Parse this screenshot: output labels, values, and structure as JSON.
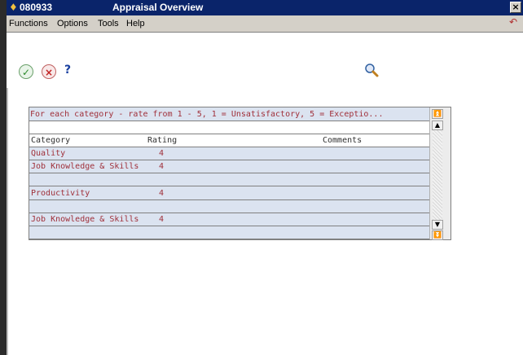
{
  "window": {
    "id": "080933",
    "title": "Appraisal Overview",
    "close_label": "×"
  },
  "menu": {
    "items": [
      "Functions",
      "Options",
      "Tools",
      "Help"
    ]
  },
  "toolbar": {
    "ok_icon": "checkmark-icon",
    "cancel_icon": "cancel-icon",
    "help_label": "?",
    "search_icon": "magnifier-icon"
  },
  "grid": {
    "instruction": "For each category - rate from 1 - 5, 1 = Unsatisfactory, 5 = Exceptio...",
    "columns": [
      "Category",
      "Rating",
      "Comments"
    ],
    "rows": [
      {
        "category": "",
        "rating": "",
        "comments": ""
      },
      {
        "category": "Quality",
        "rating": "4",
        "comments": ""
      },
      {
        "category": "Job Knowledge & Skills",
        "rating": "4",
        "comments": ""
      },
      {
        "category": "",
        "rating": "",
        "comments": ""
      },
      {
        "category": "Productivity",
        "rating": "4",
        "comments": ""
      },
      {
        "category": "",
        "rating": "",
        "comments": ""
      },
      {
        "category": "Job Knowledge & Skills",
        "rating": "4",
        "comments": ""
      },
      {
        "category": "",
        "rating": "",
        "comments": ""
      }
    ]
  },
  "colors": {
    "titlebar": "#0a246a",
    "grid_text": "#a0303a",
    "row_highlight": "#dbe3f0"
  }
}
